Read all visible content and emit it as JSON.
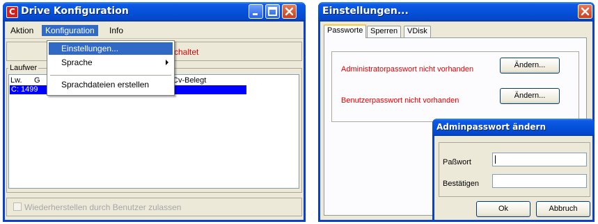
{
  "win1": {
    "title": "Drive Konfiguration",
    "app_icon_letter": "C",
    "menu": {
      "aktion": "Aktion",
      "konfiguration": "Konfiguration",
      "info": "Info"
    },
    "status_text": "schaltet",
    "group_title": "Laufwer",
    "list_headers": [
      "Lw.",
      "G",
      "Cv-Belegt"
    ],
    "list_row": "C:  1499",
    "dropdown": {
      "items": [
        "Einstellungen...",
        "Sprache",
        "Sprachdateien erstellen"
      ]
    },
    "checkbox_label": "Wiederherstellen durch Benutzer zulassen",
    "colors": {
      "titlebar": "#0450d8",
      "selection": "#316ac5",
      "status": "#e00000"
    }
  },
  "win2": {
    "title": "Einstellungen...",
    "tabs": [
      "Passworte",
      "Sperren",
      "VDisk"
    ],
    "admin_label": "Administratorpasswort nicht vorhanden",
    "user_label": "Benutzerpasswort nicht vorhanden",
    "change_button": "Ändern..."
  },
  "dialog": {
    "title": "Adminpasswort ändern",
    "password_label": "Paßwort",
    "confirm_label": "Bestätigen",
    "ok_button": "Ok",
    "cancel_button": "Abbruch"
  }
}
